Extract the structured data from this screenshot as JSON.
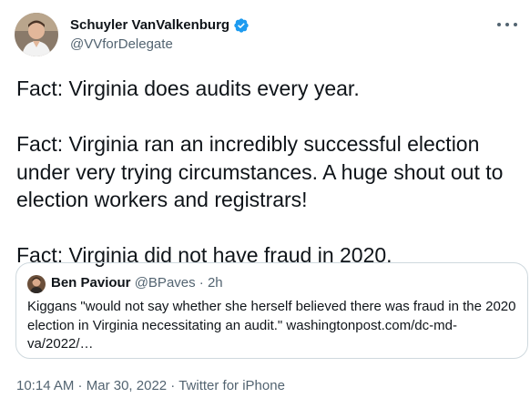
{
  "author": {
    "display_name": "Schuyler VanValkenburg",
    "handle": "@VVforDelegate",
    "verified": true,
    "avatar_icon": "profile-photo"
  },
  "more_icon": "more-horizontal-icon",
  "tweet": {
    "paragraphs": [
      "Fact: Virginia does audits every year.",
      "Fact: Virginia ran an incredibly successful election under very trying circumstances. A huge shout out to election workers and registrars!",
      "Fact: Virginia did not have fraud in 2020."
    ]
  },
  "quote": {
    "display_name": "Ben Paviour",
    "handle": "@BPaves",
    "separator": "·",
    "time": "2h",
    "text": "Kiggans \"would not say whether she herself believed there was fraud in the 2020 election in Virginia necessitating an audit.\" washingtonpost.com/dc-md-va/2022/…"
  },
  "footer": {
    "time": "10:14 AM",
    "sep1": " · ",
    "date": "Mar 30, 2022",
    "sep2": " · ",
    "source": "Twitter for iPhone"
  },
  "colors": {
    "text": "#0f1419",
    "secondary": "#536471",
    "border": "#cfd9de",
    "verified": "#1d9bf0"
  }
}
